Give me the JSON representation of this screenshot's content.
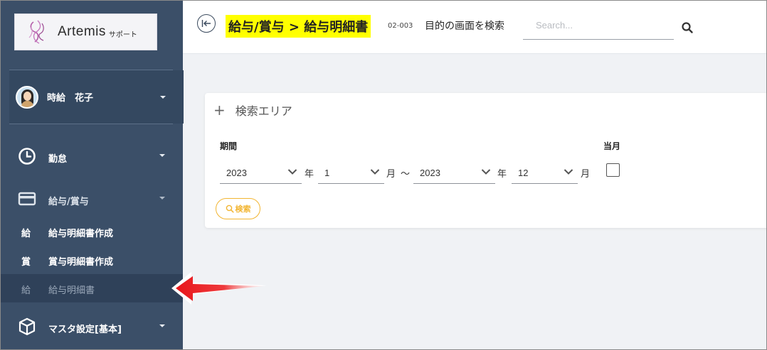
{
  "sidebar": {
    "logo": {
      "brand": "Artemis",
      "sub": "サポート"
    },
    "user": {
      "name": "時給　花子"
    },
    "menu": [
      {
        "label": "勤怠",
        "icon": "clock-icon"
      },
      {
        "label": "給与/賞与",
        "icon": "credit-card-icon"
      },
      {
        "label": "マスタ設定[基本]",
        "icon": "box-icon"
      }
    ],
    "submenu": [
      {
        "kanji": "給",
        "label": "給与明細書作成"
      },
      {
        "kanji": "賞",
        "label": "賞与明細書作成"
      },
      {
        "kanji": "給",
        "label": "給与明細書"
      }
    ]
  },
  "header": {
    "title": "給与/賞与 > 給与明細書",
    "code": "02-003",
    "search_label": "目的の画面を検索",
    "search_placeholder": "Search..."
  },
  "search_area": {
    "title": "検索エリア",
    "period_label": "期間",
    "current_month_label": "当月",
    "from_year": "2023",
    "from_month": "1",
    "to_year": "2023",
    "to_month": "12",
    "year_unit": "年",
    "month_unit": "月",
    "range_sep": "～",
    "search_button": "検索"
  },
  "colors": {
    "sidebar_bg": "#3b4f68",
    "title_highlight": "#ffff00",
    "search_button": "#f2b531",
    "arrow": "#e8161b"
  }
}
